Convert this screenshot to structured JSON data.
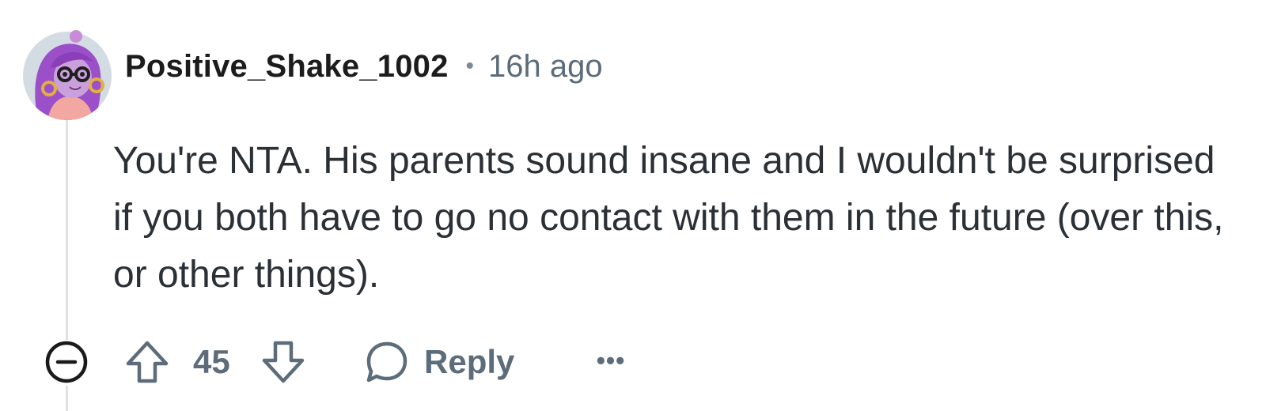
{
  "comment": {
    "username": "Positive_Shake_1002",
    "separator": "•",
    "timestamp": "16h ago",
    "body": "You're NTA. His parents sound insane and I wouldn't be surprised if you both have to go no contact with them in the future (over this, or other things).",
    "avatar_icon": "cartoon-avatar-purple-hair-glasses",
    "score": "45",
    "reply_label": "Reply",
    "more_label": "•••",
    "icons": {
      "collapse": "minus-circle-icon",
      "upvote": "arrow-up-icon",
      "downvote": "arrow-down-icon",
      "reply": "speech-bubble-icon",
      "more": "ellipsis-icon"
    },
    "colors": {
      "muted": "#5c6c7a",
      "thread_line": "#e0e3e6",
      "avatar_background": "#cfd8e1",
      "avatar_hair": "#9b4fc9"
    }
  }
}
